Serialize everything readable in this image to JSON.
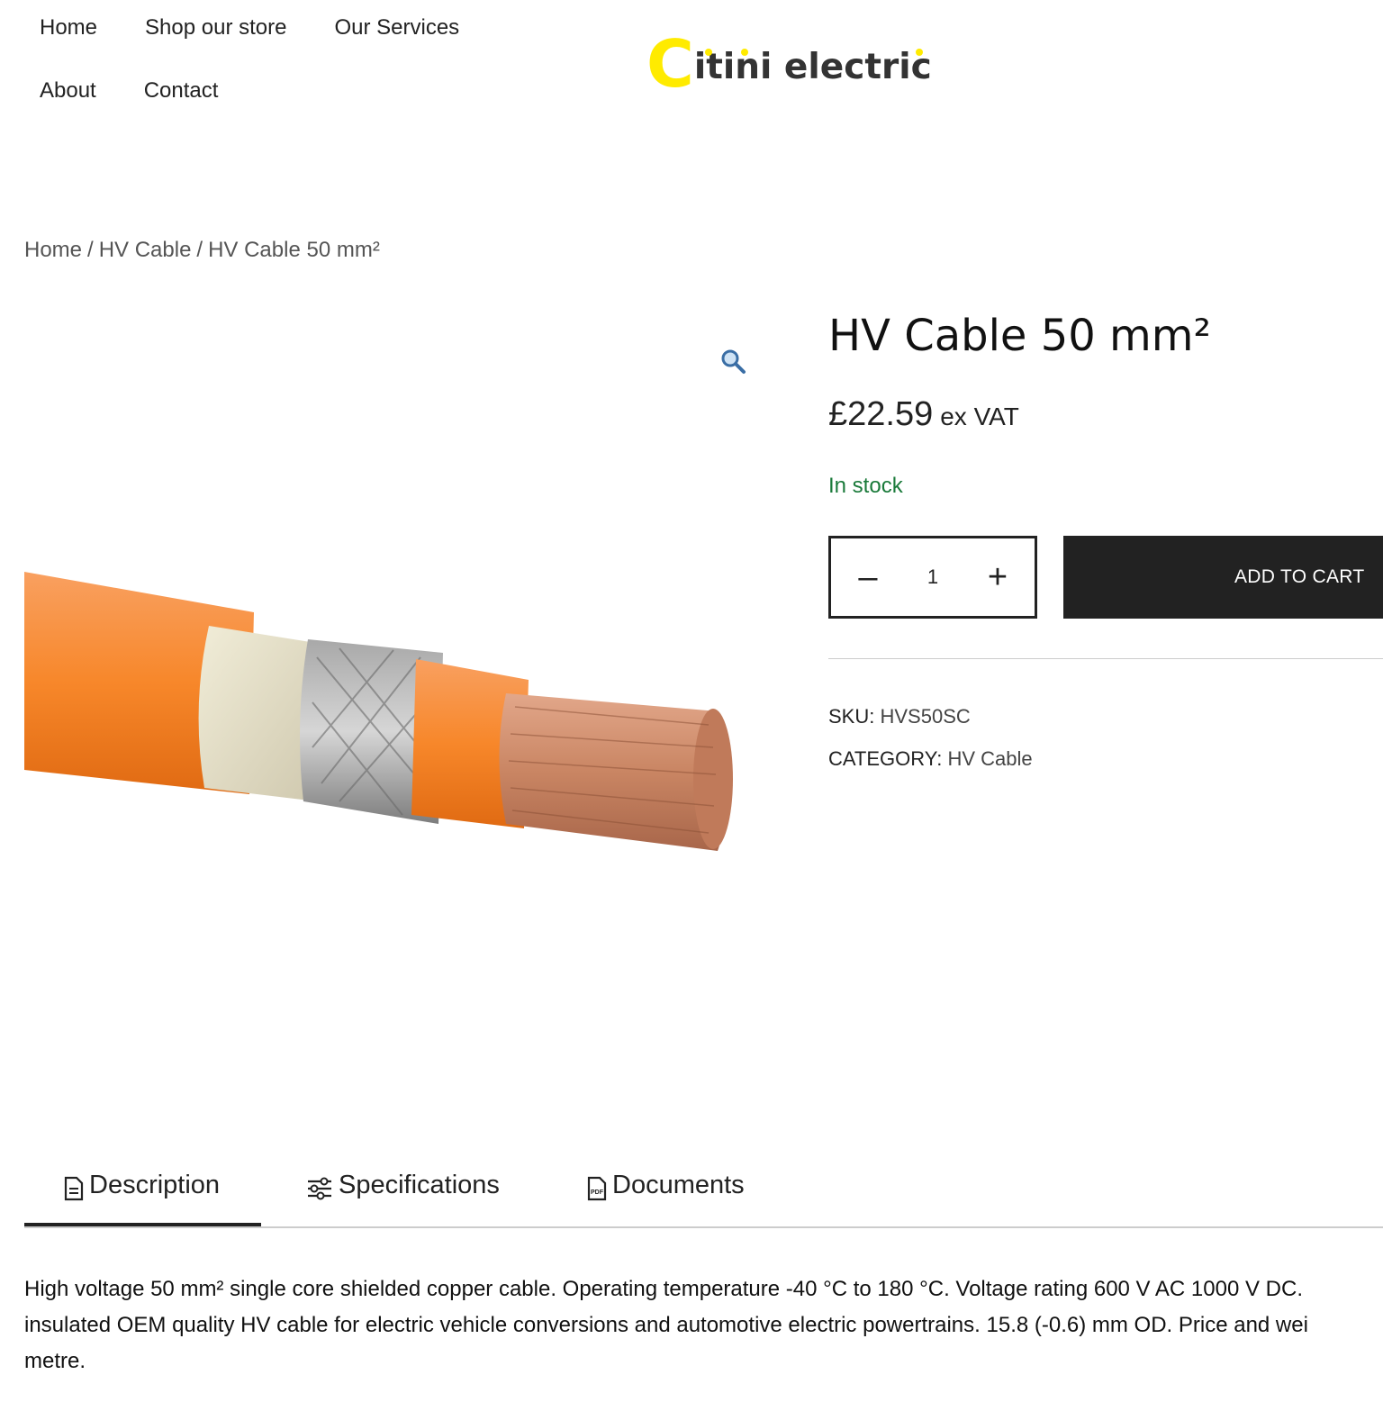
{
  "nav": {
    "items": [
      "Home",
      "Shop our store",
      "Our Services",
      "About",
      "Contact"
    ]
  },
  "logo": {
    "letter": "C",
    "rest": "itini electric",
    "accent_color": "#ffeb00"
  },
  "breadcrumb": {
    "items": [
      "Home",
      "HV Cable",
      "HV Cable 50 mm²"
    ],
    "separator": "/"
  },
  "product": {
    "title": "HV Cable 50 mm²",
    "price": "£22.59",
    "price_suffix": "ex VAT",
    "stock": "In stock",
    "quantity": "1",
    "qty_minus": "–",
    "qty_plus": "+",
    "add_to_cart": "ADD TO CART",
    "sku_label": "SKU:",
    "sku": "HVS50SC",
    "category_label": "CATEGORY:",
    "category": "HV Cable",
    "zoom_icon": "magnifier-icon",
    "image_alt": "orange shielded HV cable with exposed copper strands"
  },
  "tabs": [
    {
      "label": "Description",
      "icon": "document-icon",
      "active": true
    },
    {
      "label": "Specifications",
      "icon": "sliders-icon",
      "active": false
    },
    {
      "label": "Documents",
      "icon": "pdf-icon",
      "active": false
    }
  ],
  "description": {
    "line1": "High voltage 50 mm² single core shielded copper cable. Operating temperature -40 °C to 180 °C. Voltage rating 600 V AC 1000 V DC.",
    "line2": "insulated OEM quality HV cable for electric vehicle conversions and automotive electric powertrains. 15.8 (-0.6) mm OD. Price and wei",
    "line3": "metre."
  },
  "colors": {
    "stock_green": "#1a7a3a",
    "button_dark": "#222222",
    "cable_orange": "#f7872a",
    "copper": "#c98563"
  }
}
